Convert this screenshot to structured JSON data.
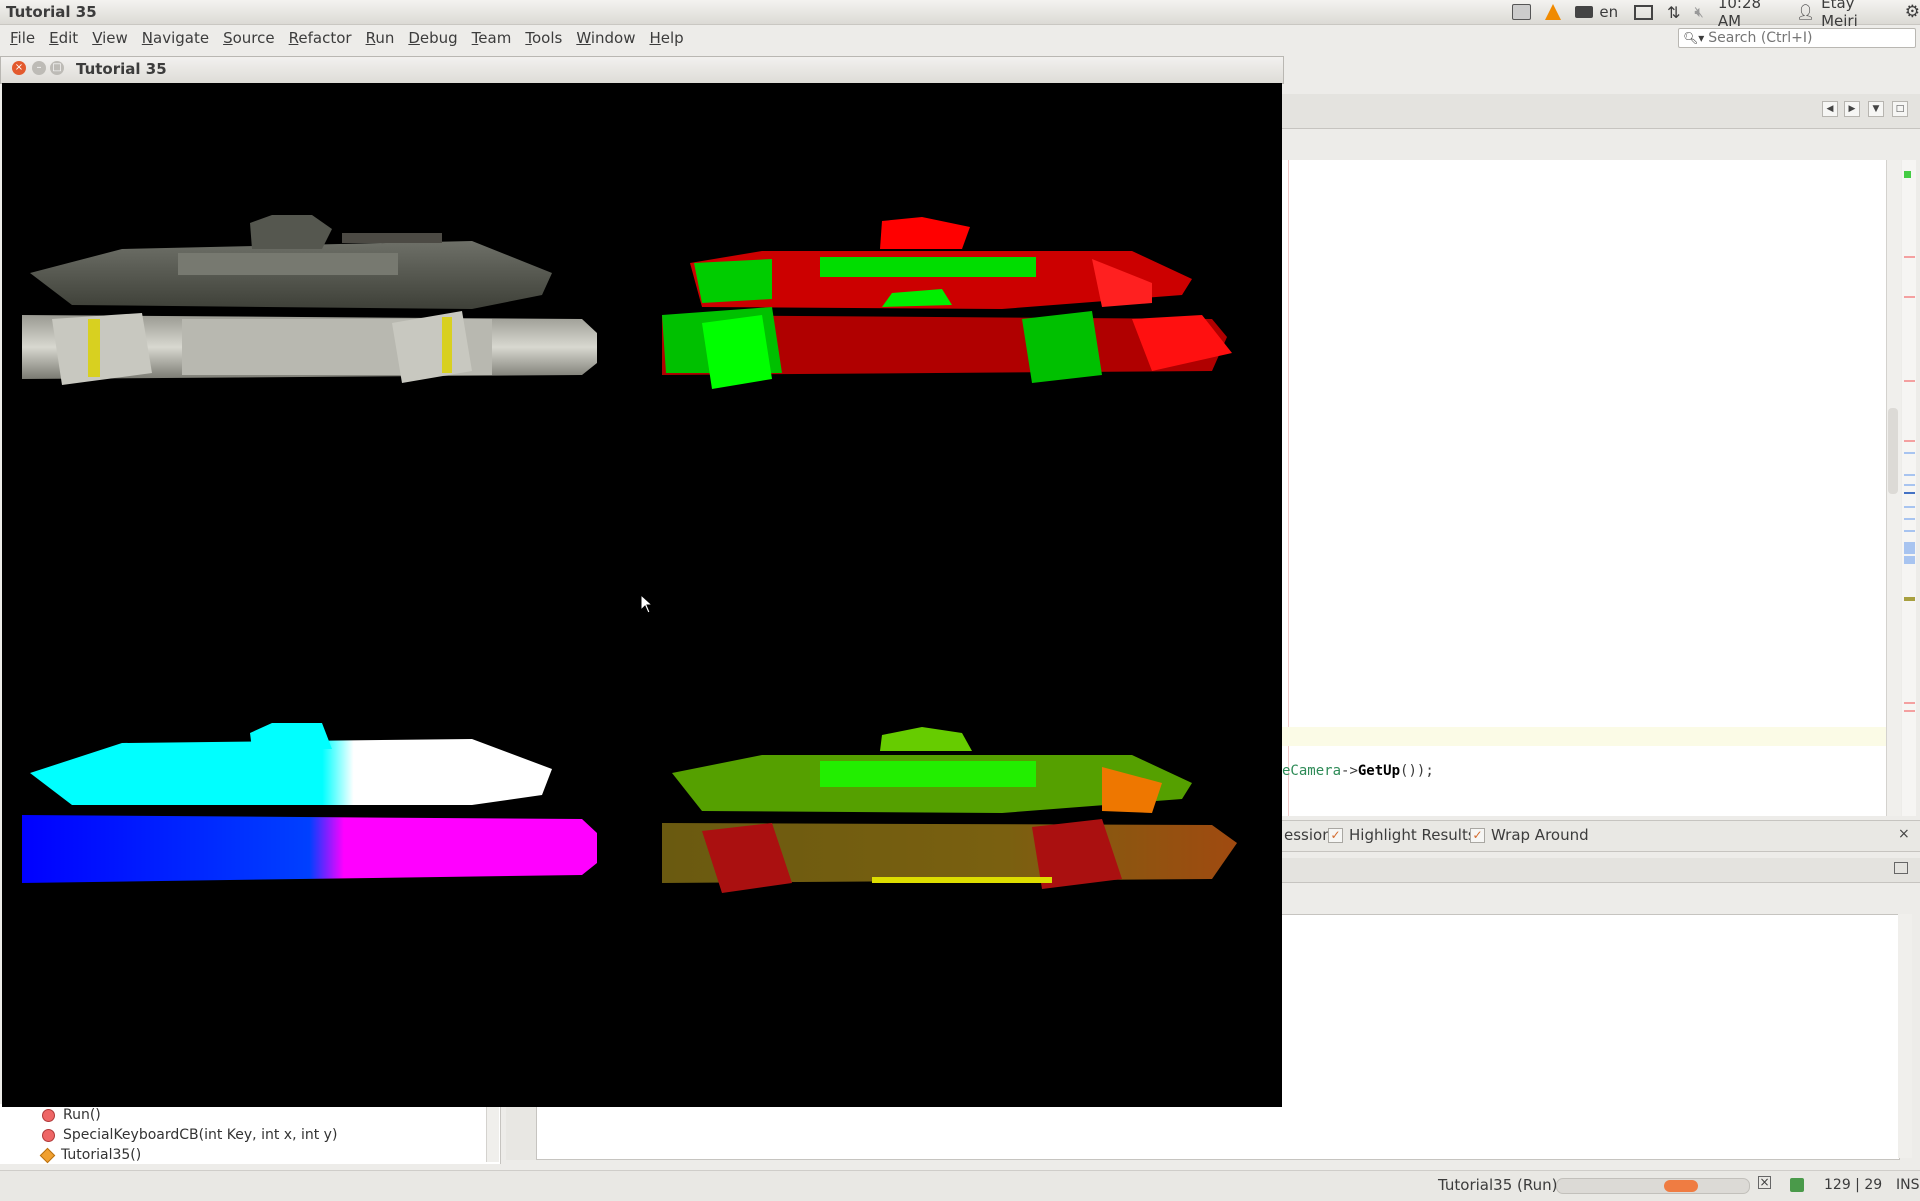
{
  "topbar": {
    "app_title": "Tutorial 35",
    "keyboard_layout": "en",
    "clock": "10:28 AM",
    "user": "Etay Meiri"
  },
  "menubar": {
    "items": [
      "File",
      "Edit",
      "View",
      "Navigate",
      "Source",
      "Refactor",
      "Run",
      "Debug",
      "Team",
      "Tools",
      "Window",
      "Help"
    ]
  },
  "search": {
    "placeholder": "Search (Ctrl+I)"
  },
  "editor": {
    "code_prefix": "eCamera",
    "code_arrow": "->",
    "code_method": "GetUp",
    "code_suffix": "());"
  },
  "find_bar": {
    "partial_option": "ession",
    "highlight_results": "Highlight Results",
    "wrap_around": "Wrap Around",
    "close": "×"
  },
  "navigator": {
    "items": [
      {
        "label": "Run()",
        "kind": "method"
      },
      {
        "label": "SpecialKeyboardCB(int Key, int x, int y)",
        "kind": "method"
      },
      {
        "label": "Tutorial35()",
        "kind": "constructor"
      }
    ]
  },
  "statusbar": {
    "run_label": "Tutorial35 (Run)",
    "position": "129 | 29",
    "mode": "INS",
    "cancel": "×"
  },
  "game_window": {
    "title": "Tutorial 35",
    "viewports": [
      "textured",
      "normals",
      "position",
      "diffuse"
    ]
  },
  "colors": {
    "canvas": "#000000",
    "progress": "#ef7c42",
    "code_identifier": "#2e8b57"
  }
}
